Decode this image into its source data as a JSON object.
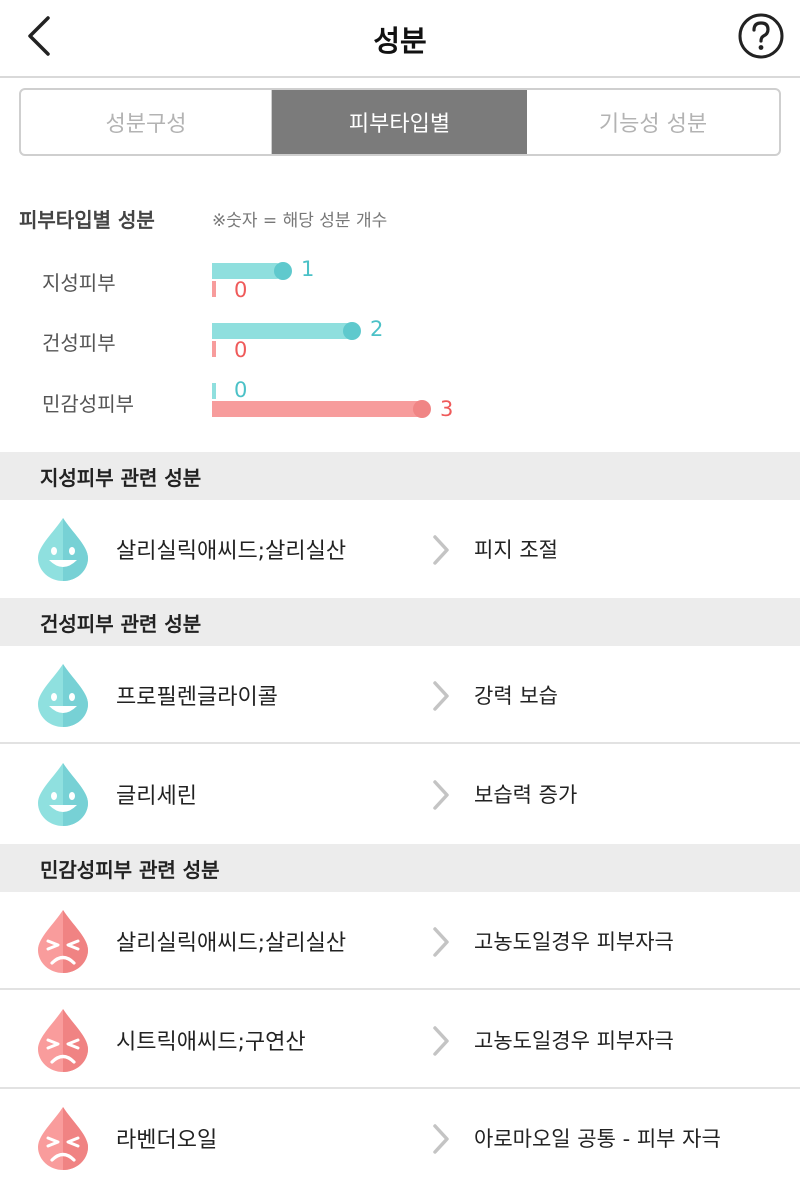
{
  "header": {
    "title": "성분",
    "back_icon": "chevron-left-icon",
    "help_icon": "question-circle-icon"
  },
  "tabs": [
    {
      "label": "성분구성",
      "active": false
    },
    {
      "label": "피부타입별",
      "active": true
    },
    {
      "label": "기능성 성분",
      "active": false
    }
  ],
  "summary": {
    "title": "피부타입별 성분",
    "note": "※숫자 = 해당 성분 개수"
  },
  "skin_types": [
    {
      "label": "지성피부",
      "good": "1",
      "bad": "0"
    },
    {
      "label": "건성피부",
      "good": "2",
      "bad": "0"
    },
    {
      "label": "민감성피부",
      "good": "0",
      "bad": "3"
    }
  ],
  "sections": [
    {
      "title": "지성피부 관련 성분",
      "items": [
        {
          "name": "살리실릭애씨드;살리실산",
          "effect": "피지 조절",
          "icon": "happy-drop-icon"
        }
      ]
    },
    {
      "title": "건성피부 관련 성분",
      "items": [
        {
          "name": "프로필렌글라이콜",
          "effect": "강력 보습",
          "icon": "happy-drop-icon"
        },
        {
          "name": "글리세린",
          "effect": "보습력 증가",
          "icon": "happy-drop-icon"
        }
      ]
    },
    {
      "title": "민감성피부 관련 성분",
      "items": [
        {
          "name": "살리실릭애씨드;살리실산",
          "effect": "고농도일경우 피부자극",
          "icon": "sad-drop-icon"
        },
        {
          "name": "시트릭애씨드;구연산",
          "effect": "고농도일경우 피부자극",
          "icon": "sad-drop-icon"
        },
        {
          "name": "라벤더오일",
          "effect": "아로마오일 공통 - 피부 자극",
          "icon": "sad-drop-icon"
        }
      ]
    }
  ],
  "colors": {
    "good": "#8fdfde",
    "good_text": "#4bc1c7",
    "bad": "#f79c9c",
    "bad_text": "#ef5a5a",
    "active_tab": "#7b7b7b"
  }
}
